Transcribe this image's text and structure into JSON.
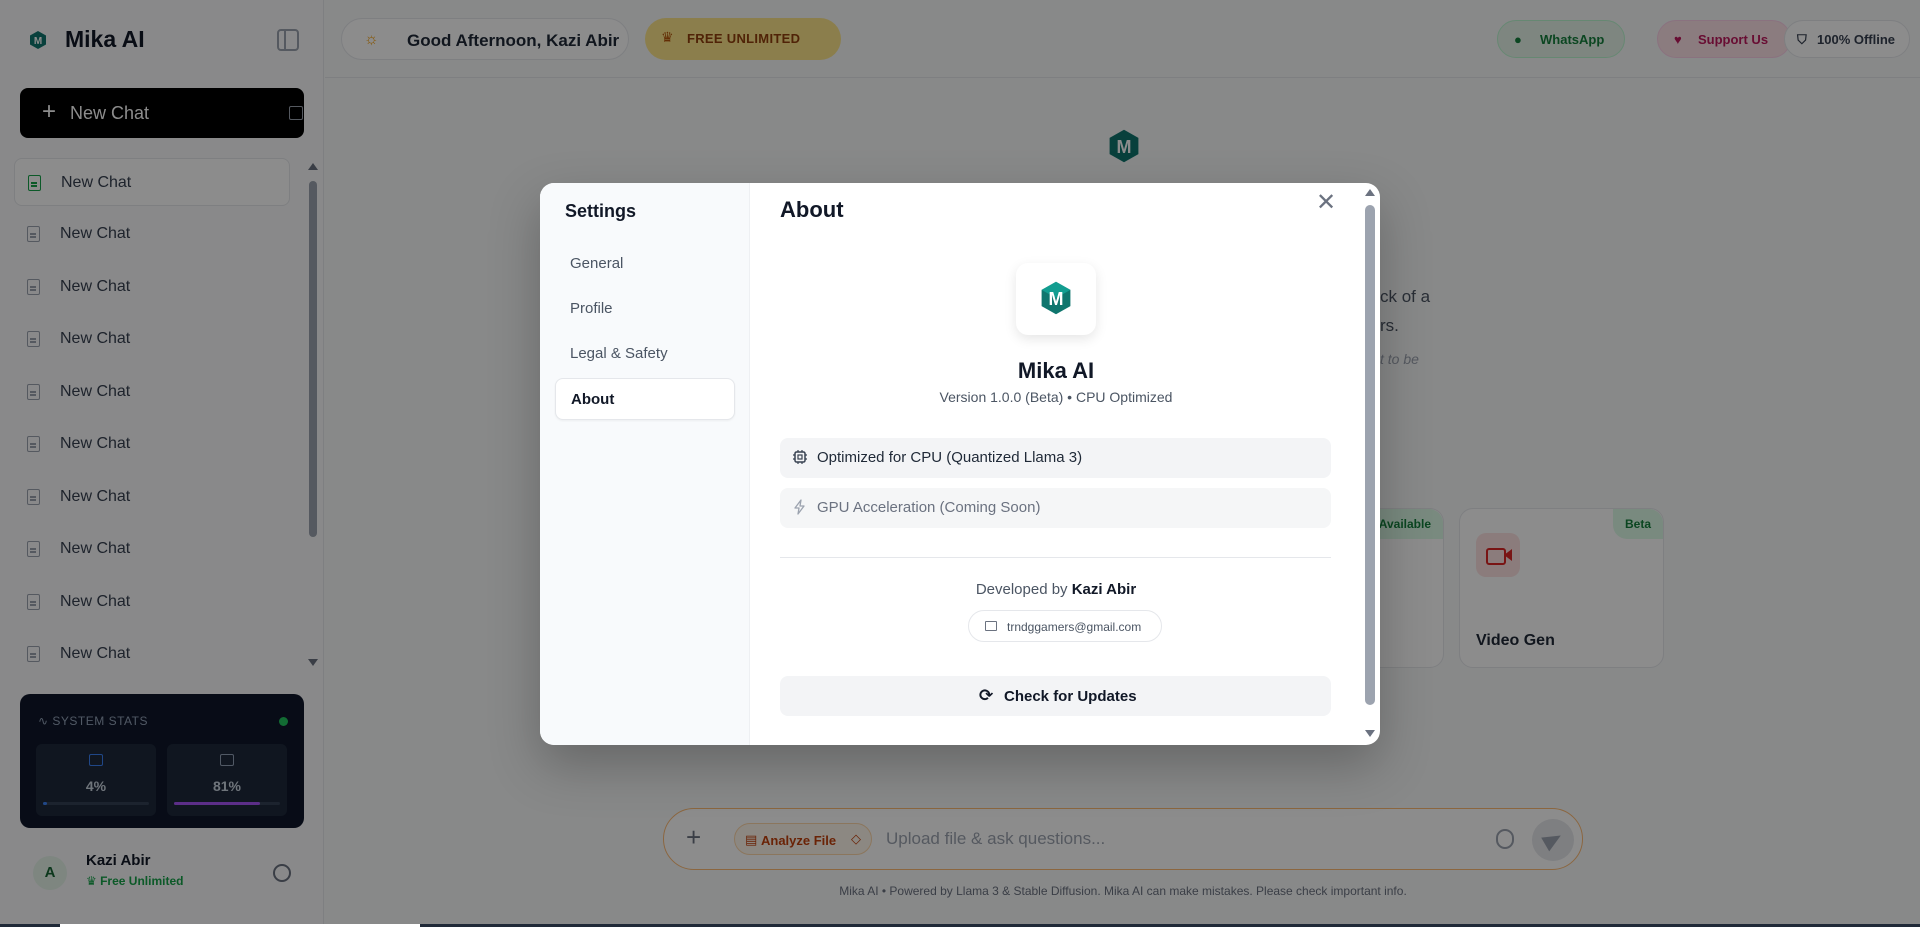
{
  "app": {
    "brand": "Mika AI"
  },
  "sidebar": {
    "new_chat_label": "New Chat",
    "chats": [
      "New Chat",
      "New Chat",
      "New Chat",
      "New Chat",
      "New Chat",
      "New Chat",
      "New Chat",
      "New Chat",
      "New Chat",
      "New Chat"
    ],
    "stats": {
      "title": "SYSTEM STATS",
      "cpu_value": "4%",
      "cpu_fraction": 0.04,
      "mem_value": "81%",
      "mem_fraction": 0.81
    },
    "user": {
      "initial": "A",
      "name": "Kazi Abir",
      "plan": "Free Unlimited"
    }
  },
  "header": {
    "greeting": "Good Afternoon, Kazi Abir",
    "free_badge": "FREE UNLIMITED",
    "whatsapp": "WhatsApp",
    "support": "Support Us",
    "offline": "100% Offline"
  },
  "main": {
    "bg_fragment_1": "ck of a",
    "bg_fragment_2": "rs.",
    "bg_fragment_3": "t to be",
    "card_badge_available": "Available",
    "card_badge_beta": "Beta",
    "card_video_gen": "Video Gen",
    "composer": {
      "chip_label": "Analyze File",
      "placeholder": "Upload file & ask questions..."
    },
    "footer_note": "Mika AI • Powered by Llama 3 & Stable Diffusion. Mika AI can make mistakes. Please check important info."
  },
  "settings_modal": {
    "sidebar_title": "Settings",
    "tabs": [
      "General",
      "Profile",
      "Legal & Safety",
      "About"
    ],
    "active_tab": "About",
    "title": "About",
    "app_name": "Mika AI",
    "version": "Version 1.0.0 (Beta) • CPU Optimized",
    "features": [
      {
        "label": "Optimized for CPU (Quantized Llama 3)",
        "icon": "cpu-icon",
        "enabled": true
      },
      {
        "label": "GPU Acceleration (Coming Soon)",
        "icon": "lightning-icon",
        "enabled": false
      }
    ],
    "developed_by_prefix": "Developed by",
    "developer": "Kazi Abir",
    "email": "trndggamers@gmail.com",
    "update_button": "Check for Updates"
  },
  "colors": {
    "accent_green": "#16a34a",
    "logo_teal": "#0f766e",
    "overlay": "rgba(0,0,0,0.45)"
  }
}
